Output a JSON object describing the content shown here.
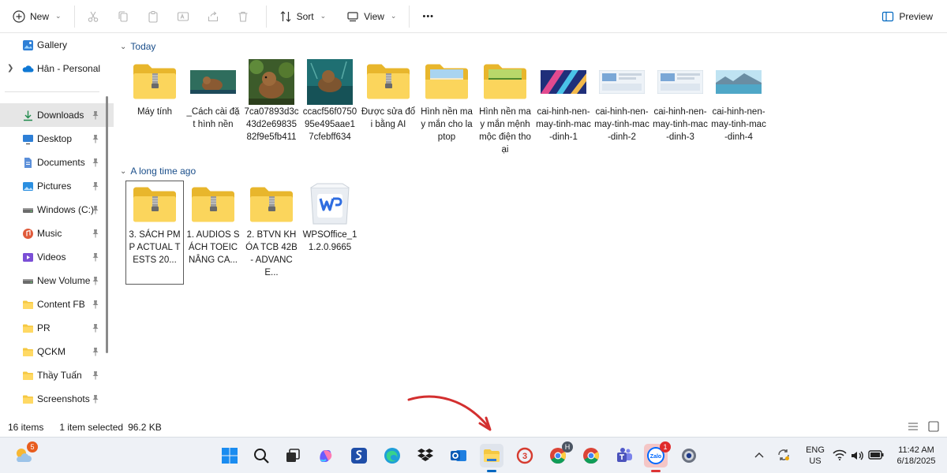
{
  "toolbar": {
    "new_label": "New",
    "sort_label": "Sort",
    "view_label": "View",
    "more_label": "•••",
    "preview_label": "Preview"
  },
  "sidebar": {
    "top_items": [
      {
        "label": "Gallery",
        "icon": "gallery-icon"
      },
      {
        "label": "Hân - Personal",
        "icon": "onedrive-icon"
      }
    ],
    "items": [
      {
        "label": "Downloads",
        "icon": "download-icon"
      },
      {
        "label": "Desktop",
        "icon": "desktop-icon"
      },
      {
        "label": "Documents",
        "icon": "documents-icon"
      },
      {
        "label": "Pictures",
        "icon": "pictures-icon"
      },
      {
        "label": "Windows (C:)",
        "icon": "drive-icon"
      },
      {
        "label": "Music",
        "icon": "music-icon"
      },
      {
        "label": "Videos",
        "icon": "videos-icon"
      },
      {
        "label": "New Volume",
        "icon": "drive-icon"
      },
      {
        "label": "Content FB",
        "icon": "folder-icon"
      },
      {
        "label": "PR",
        "icon": "folder-icon"
      },
      {
        "label": "QCKM",
        "icon": "folder-icon"
      },
      {
        "label": "Thầy Tuấn",
        "icon": "folder-icon"
      },
      {
        "label": "Screenshots",
        "icon": "folder-icon"
      }
    ]
  },
  "groups": {
    "today": {
      "label": "Today",
      "files": [
        {
          "name": "Máy tính",
          "kind": "zip-folder"
        },
        {
          "name": "_Cách cài đặt hình nền",
          "kind": "image-capybara-wide"
        },
        {
          "name": "7ca07893d3c43d2e6983582f9e5fb411",
          "kind": "image-capybara-forest"
        },
        {
          "name": "ccacf56f075095e495aae17cfebff634",
          "kind": "image-capybara-water"
        },
        {
          "name": "Được sửa đổi bằng AI",
          "kind": "zip-folder"
        },
        {
          "name": "Hình nền may mắn cho laptop",
          "kind": "folder-preview-sky"
        },
        {
          "name": "Hình nền may mắn mệnh mộc điện thoại",
          "kind": "folder-preview-green"
        },
        {
          "name": "cai-hinh-nen-may-tinh-mac-dinh-1",
          "kind": "image-abstract"
        },
        {
          "name": "cai-hinh-nen-may-tinh-mac-dinh-2",
          "kind": "image-screenshot"
        },
        {
          "name": "cai-hinh-nen-may-tinh-mac-dinh-3",
          "kind": "image-screenshot"
        },
        {
          "name": "cai-hinh-nen-may-tinh-mac-dinh-4",
          "kind": "image-landscape"
        }
      ]
    },
    "older": {
      "label": "A long time ago",
      "files": [
        {
          "name": "3. SÁCH PMP ACTUAL TESTS 20...",
          "kind": "zip-folder"
        },
        {
          "name": "1. AUDIOS SÁCH TOEIC NÂNG CA...",
          "kind": "zip-folder"
        },
        {
          "name": "2. BTVN KHÓA TCB 42B - ADVANCE...",
          "kind": "zip-folder"
        },
        {
          "name": "WPSOffice_11.2.0.9665",
          "kind": "wps-installer"
        }
      ]
    }
  },
  "status": {
    "count": "16 items",
    "selection": "1 item selected",
    "size": "96.2 KB"
  },
  "taskbar": {
    "weather_badge": "5",
    "zalo_badge": "1",
    "zalo_label": "Zalo",
    "chrome_profile_badge": "H"
  },
  "tray": {
    "lang_top": "ENG",
    "lang_bottom": "US",
    "time": "11:42 AM",
    "date": "6/18/2025"
  },
  "colors": {
    "accent": "#0067c0",
    "annotation_arrow": "#d32f2f",
    "folder": "#f5c842"
  }
}
